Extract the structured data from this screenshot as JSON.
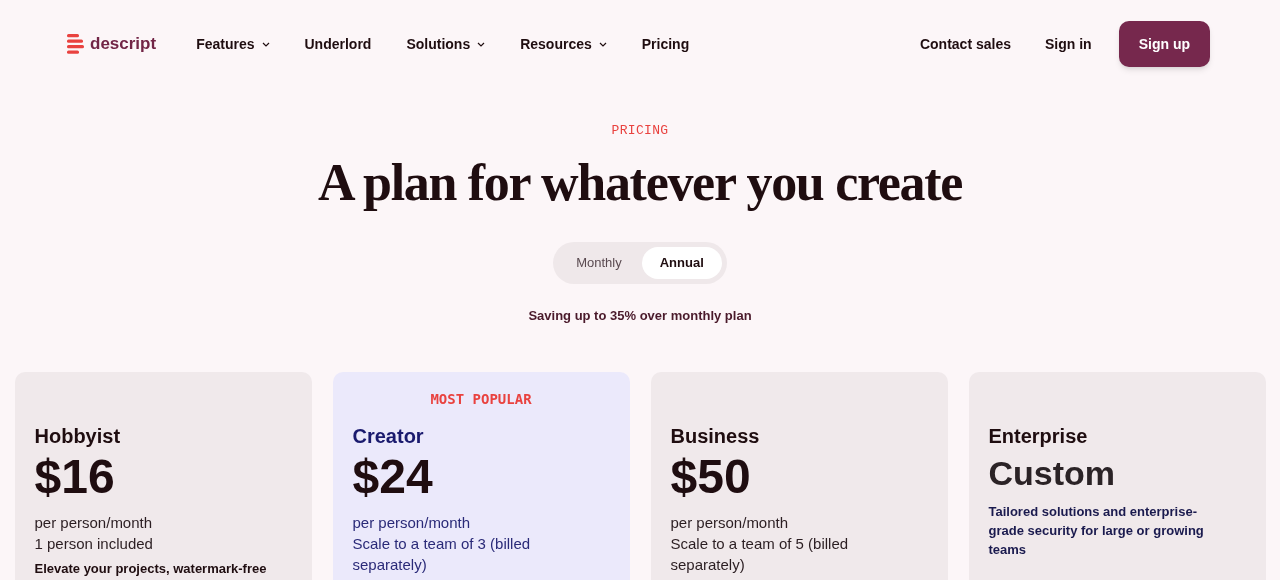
{
  "nav": {
    "logo": "descript",
    "links": [
      {
        "label": "Features",
        "dropdown": true
      },
      {
        "label": "Underlord",
        "dropdown": false
      },
      {
        "label": "Solutions",
        "dropdown": true
      },
      {
        "label": "Resources",
        "dropdown": true
      },
      {
        "label": "Pricing",
        "dropdown": false
      }
    ],
    "actions": [
      "Contact sales",
      "Sign in"
    ],
    "cta": "Sign up"
  },
  "hero": {
    "eyebrow": "PRICING",
    "title": "A plan for whatever you create",
    "billing": [
      {
        "label": "Monthly",
        "selected": false
      },
      {
        "label": "Annual",
        "selected": true
      }
    ],
    "note": "Saving up to 35% over monthly plan"
  },
  "plans": [
    {
      "name": "Hobbyist",
      "kind": "price",
      "featured": false,
      "price": "$16",
      "lines": [
        "per person/month",
        "1 person included"
      ],
      "description": "Elevate your projects, watermark-free"
    },
    {
      "name": "Creator",
      "kind": "price",
      "featured": true,
      "badge": "MOST POPULAR",
      "price": "$24",
      "lines": [
        "per person/month",
        "Scale to a team of 3 (billed separately)"
      ]
    },
    {
      "name": "Business",
      "kind": "price",
      "featured": false,
      "price": "$50",
      "lines": [
        "per person/month",
        "Scale to a team of 5 (billed separately)"
      ]
    },
    {
      "name": "Enterprise",
      "kind": "custom",
      "featured": false,
      "price": "Custom",
      "description": "Tailored solutions and enterprise-grade security for large or growing teams"
    }
  ]
}
